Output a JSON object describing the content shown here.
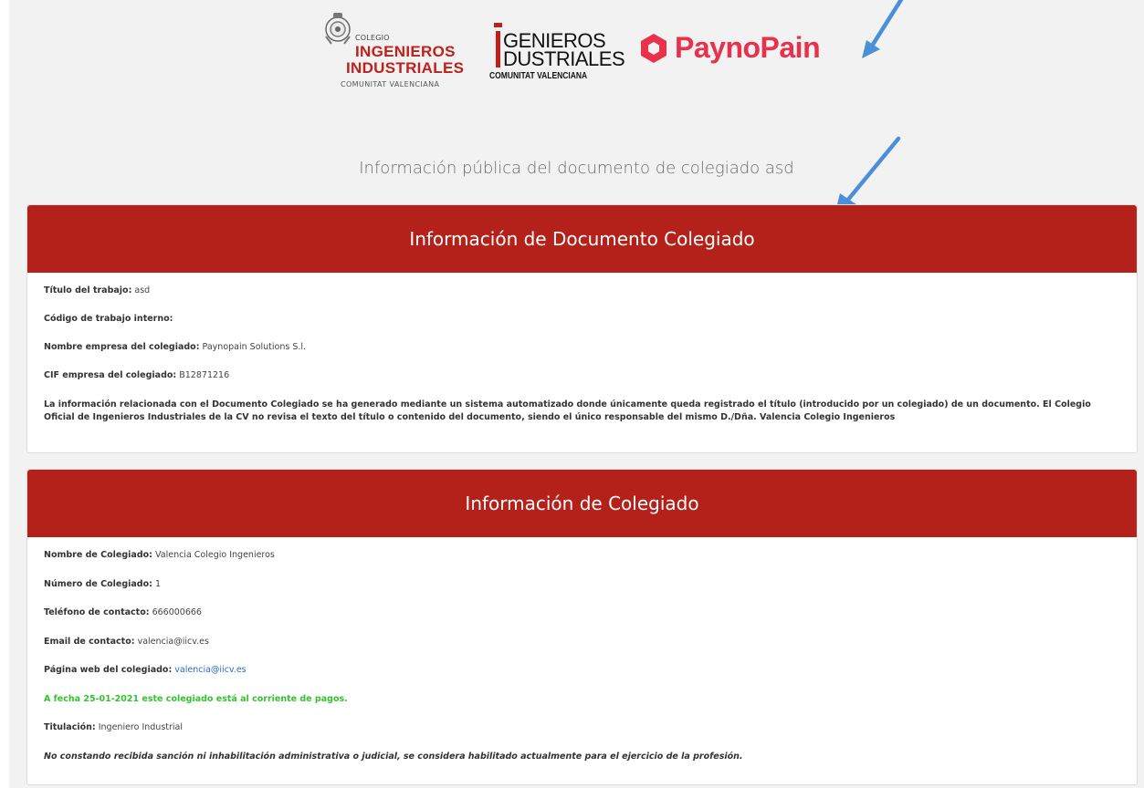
{
  "logos": {
    "colegio": {
      "small": "COLEGIO",
      "line1": "INGENIEROS",
      "line2": "INDUSTRIALES",
      "sub": "COMUNITAT VALENCIANA"
    },
    "ingenieros": {
      "line1": "GENIEROS",
      "line2": "DUSTRIALES",
      "sub": "COMUNITAT VALENCIANA"
    },
    "paynopain": {
      "text": "PaynoPain"
    }
  },
  "page_heading": "Información pública del documento de colegiado asd",
  "document_panel": {
    "title": "Información de Documento Colegiado",
    "fields": [
      {
        "label": "Título del trabajo:",
        "value": "asd"
      },
      {
        "label": "Código de trabajo interno:",
        "value": ""
      },
      {
        "label": "Nombre empresa del colegiado:",
        "value": "Paynopain Solutions S.l."
      },
      {
        "label": "CIF empresa del colegiado:",
        "value": "B12871216"
      }
    ],
    "notice": "La información relacionada con el Documento Colegiado se ha generado mediante un sistema automatizado donde únicamente queda registrado el título (introducido por un colegiado) de un documento. El Colegio Oficial de Ingenieros Industriales de la CV no revisa el texto del título o contenido del documento, siendo el único responsable del mismo D./Dña. Valencia Colegio Ingenieros"
  },
  "colegiado_panel": {
    "title": "Información de Colegiado",
    "fields": [
      {
        "label": "Nombre de Colegiado:",
        "value": "Valencia Colegio Ingenieros"
      },
      {
        "label": "Número de Colegiado:",
        "value": "1"
      },
      {
        "label": "Teléfono de contacto:",
        "value": "666000666"
      },
      {
        "label": "Email de contacto:",
        "value": "valencia@iicv.es"
      }
    ],
    "website": {
      "label": "Página web del colegiado:",
      "value": "valencia@iicv.es"
    },
    "payment_status": "A fecha 25-01-2021 este colegiado está al corriente de pagos.",
    "titulacion": {
      "label": "Titulación:",
      "value": "Ingeniero Industrial"
    },
    "disclaimer": "No constando recibida sanción ni inhabilitación administrativa o judicial, se considera habilitado actualmente para el ejercicio de la profesión."
  },
  "colors": {
    "header_red": "#b4211a",
    "status_green": "#35c22f",
    "link_blue": "#2a6bc4",
    "arrow_blue": "#4a8fd8",
    "paynopain_pink": "#e8314a"
  },
  "icons": [
    "colegio-crest-icon",
    "paynopain-logo-icon",
    "annotation-arrow-icon"
  ]
}
